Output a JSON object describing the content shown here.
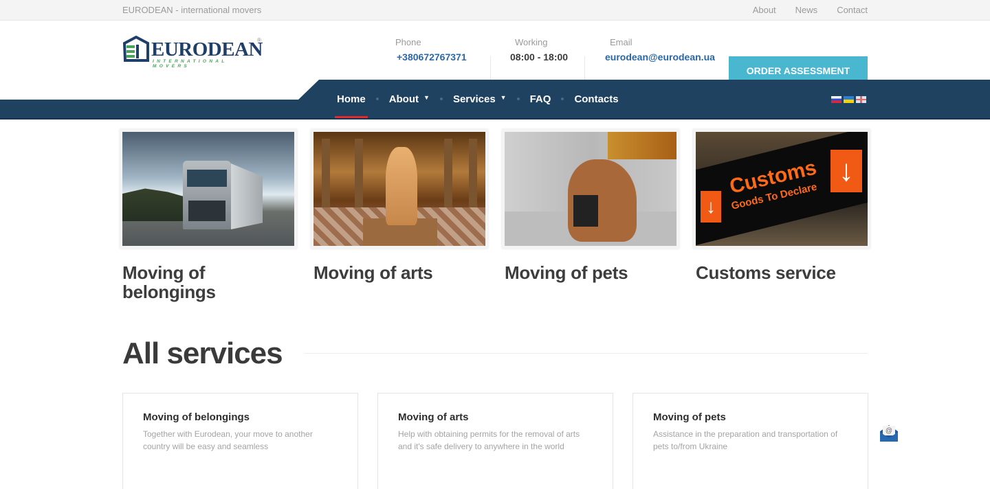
{
  "topbar": {
    "tagline": "EURODEAN - international movers",
    "links": [
      "About",
      "News",
      "Contact"
    ]
  },
  "logo": {
    "brand": "EURODEAN",
    "subtitle": "INTERNATIONAL MOVERS",
    "registered": "®"
  },
  "contacts": {
    "phone": {
      "label": "Phone",
      "value": "+380672767371"
    },
    "working": {
      "label": "Working",
      "value": "08:00 - 18:00"
    },
    "email": {
      "label": "Email",
      "value": "eurodean@eurodean.ua"
    }
  },
  "order_button": "ORDER ASSESSMENT",
  "nav": {
    "items": [
      {
        "label": "Home",
        "active": true,
        "dropdown": false
      },
      {
        "label": "About",
        "active": false,
        "dropdown": true
      },
      {
        "label": "Services",
        "active": false,
        "dropdown": true
      },
      {
        "label": "FAQ",
        "active": false,
        "dropdown": false
      },
      {
        "label": "Contacts",
        "active": false,
        "dropdown": false
      }
    ],
    "caret": "▼",
    "languages": [
      "ru",
      "ua",
      "en"
    ]
  },
  "features": [
    {
      "title": "Moving of belongings",
      "image": "truck"
    },
    {
      "title": "Moving of arts",
      "image": "statue"
    },
    {
      "title": "Moving of pets",
      "image": "dog"
    },
    {
      "title": "Customs service",
      "image": "customs-sign",
      "sign_text": "Customs",
      "sign_subtext": "Goods To Declare"
    }
  ],
  "all_services": {
    "title": "All services",
    "cards": [
      {
        "title": "Moving of belongings",
        "desc": "Together with Eurodean, your move to another country will be easy and seamless"
      },
      {
        "title": "Moving of arts",
        "desc": "Help with obtaining permits for the removal of arts and it's safe delivery to anywhere in the world"
      },
      {
        "title": "Moving of pets",
        "desc": "Assistance in the preparation and transportation of pets to/from Ukraine"
      }
    ]
  },
  "colors": {
    "nav_bg": "#1f4260",
    "accent_button": "#4ab7d1",
    "active_underline": "#e0282e",
    "link_blue": "#2a67a8",
    "logo_green": "#4aa35a",
    "logo_navy": "#1f3f6a"
  }
}
